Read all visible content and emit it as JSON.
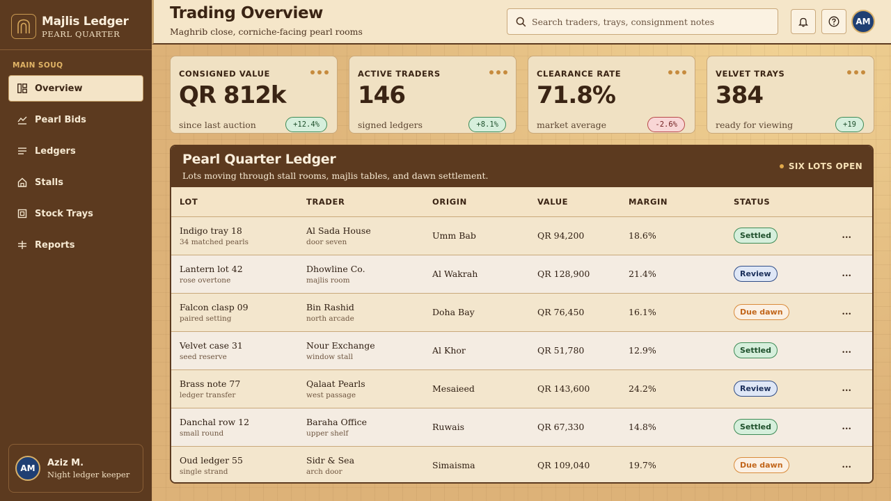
{
  "brand": {
    "name": "Majlis Ledger",
    "subtitle": "PEARL QUARTER"
  },
  "sidebar": {
    "section_label": "MAIN SOUQ",
    "items": [
      {
        "label": "Overview",
        "icon": "grid-icon",
        "active": true
      },
      {
        "label": "Pearl Bids",
        "icon": "bid-icon",
        "active": false
      },
      {
        "label": "Ledgers",
        "icon": "lines-icon",
        "active": false
      },
      {
        "label": "Stalls",
        "icon": "home-icon",
        "active": false
      },
      {
        "label": "Stock Trays",
        "icon": "tray-icon",
        "active": false
      },
      {
        "label": "Reports",
        "icon": "reports-icon",
        "active": false
      }
    ],
    "user": {
      "initials": "AM",
      "name": "Aziz M.",
      "role": "Night ledger keeper"
    }
  },
  "header": {
    "title": "Trading Overview",
    "subtitle": "Maghrib close, corniche-facing pearl rooms",
    "search_placeholder": "Search traders, trays, consignment notes",
    "avatar_initials": "AM"
  },
  "stats": [
    {
      "label": "CONSIGNED VALUE",
      "value": "QR 812k",
      "foot": "since last auction",
      "delta": "+12.4%",
      "trend": "up"
    },
    {
      "label": "ACTIVE TRADERS",
      "value": "146",
      "foot": "signed ledgers",
      "delta": "+8.1%",
      "trend": "up"
    },
    {
      "label": "CLEARANCE RATE",
      "value": "71.8%",
      "foot": "market average",
      "delta": "-2.6%",
      "trend": "down"
    },
    {
      "label": "VELVET TRAYS",
      "value": "384",
      "foot": "ready for viewing",
      "delta": "+19",
      "trend": "up"
    }
  ],
  "ledger": {
    "title": "Pearl Quarter Ledger",
    "subtitle": "Lots moving through stall rooms, majlis tables, and dawn settlement.",
    "badge": "SIX LOTS OPEN",
    "columns": [
      "LOT",
      "TRADER",
      "ORIGIN",
      "VALUE",
      "MARGIN",
      "STATUS"
    ],
    "rows": [
      {
        "lot": "Indigo tray 18",
        "lot_note": "34 matched pearls",
        "trader": "Al Sada House",
        "trader_note": "door seven",
        "origin": "Umm Bab",
        "value": "QR 94,200",
        "margin": "18.6%",
        "status": "Settled",
        "status_kind": "settled"
      },
      {
        "lot": "Lantern lot 42",
        "lot_note": "rose overtone",
        "trader": "Dhowline Co.",
        "trader_note": "majlis room",
        "origin": "Al Wakrah",
        "value": "QR 128,900",
        "margin": "21.4%",
        "status": "Review",
        "status_kind": "review"
      },
      {
        "lot": "Falcon clasp 09",
        "lot_note": "paired setting",
        "trader": "Bin Rashid",
        "trader_note": "north arcade",
        "origin": "Doha Bay",
        "value": "QR 76,450",
        "margin": "16.1%",
        "status": "Due dawn",
        "status_kind": "due"
      },
      {
        "lot": "Velvet case 31",
        "lot_note": "seed reserve",
        "trader": "Nour Exchange",
        "trader_note": "window stall",
        "origin": "Al Khor",
        "value": "QR 51,780",
        "margin": "12.9%",
        "status": "Settled",
        "status_kind": "settled"
      },
      {
        "lot": "Brass note 77",
        "lot_note": "ledger transfer",
        "trader": "Qalaat Pearls",
        "trader_note": "west passage",
        "origin": "Mesaieed",
        "value": "QR 143,600",
        "margin": "24.2%",
        "status": "Review",
        "status_kind": "review"
      },
      {
        "lot": "Danchal row 12",
        "lot_note": "small round",
        "trader": "Baraha Office",
        "trader_note": "upper shelf",
        "origin": "Ruwais",
        "value": "QR 67,330",
        "margin": "14.8%",
        "status": "Settled",
        "status_kind": "settled"
      },
      {
        "lot": "Oud ledger 55",
        "lot_note": "single strand",
        "trader": "Sidr & Sea",
        "trader_note": "arch door",
        "origin": "Simaisma",
        "value": "QR 109,040",
        "margin": "19.7%",
        "status": "Due dawn",
        "status_kind": "due"
      }
    ],
    "row_menu_label": "..."
  },
  "colors": {
    "sidebar_bg": "#5c3a1f",
    "accent_gold": "#c68b3e",
    "settled": "#3d8a55",
    "review": "#2f4c86",
    "due": "#d98a3a",
    "negative": "#b84848"
  }
}
